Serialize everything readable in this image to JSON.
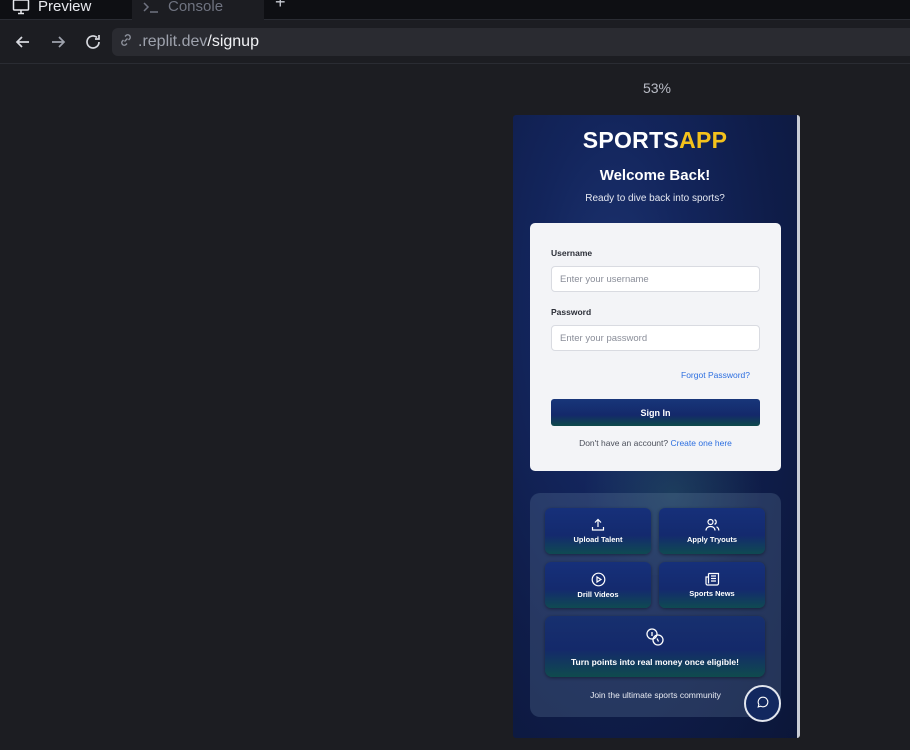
{
  "tabs": [
    {
      "label": "Preview",
      "icon": "monitor-icon"
    },
    {
      "label": "Console",
      "icon": "terminal-icon"
    }
  ],
  "new_tab_label": "+",
  "address": {
    "domain": ".replit.dev",
    "path": "/signup"
  },
  "zoom": "53%",
  "app": {
    "logo_main": "SPORTS",
    "logo_accent": "APP",
    "welcome": "Welcome Back!",
    "subtitle": "Ready to dive back into sports?",
    "colors": {
      "accent": "#f4c21c",
      "link": "#2d6fe0",
      "background": "#13255c"
    }
  },
  "form": {
    "username_label": "Username",
    "username_placeholder": "Enter your username",
    "password_label": "Password",
    "password_placeholder": "Enter your password",
    "forgot": "Forgot Password?",
    "signin": "Sign In",
    "no_account": "Don't have an account?",
    "create_link": "Create one here"
  },
  "features": {
    "tiles": [
      {
        "label": "Upload Talent",
        "icon": "upload-icon"
      },
      {
        "label": "Apply Tryouts",
        "icon": "users-icon"
      },
      {
        "label": "Drill Videos",
        "icon": "play-circle-icon"
      },
      {
        "label": "Sports News",
        "icon": "newspaper-icon"
      }
    ],
    "rewards": "Turn points into real money once eligible!",
    "community": "Join the ultimate sports community"
  }
}
